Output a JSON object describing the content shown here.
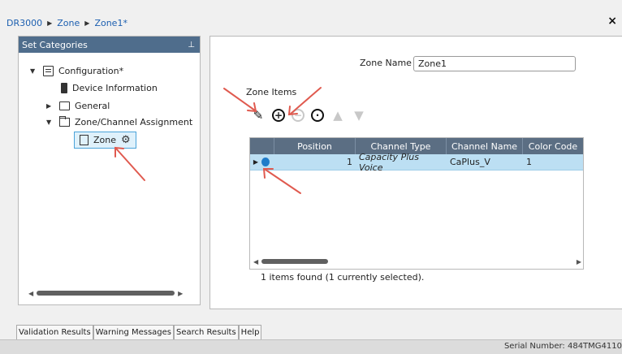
{
  "breadcrumb": {
    "items": [
      "DR3000",
      "Zone",
      "Zone1*"
    ]
  },
  "close_label": "×",
  "left_panel": {
    "title": "Set Categories",
    "pin_icon": "pin-icon",
    "tree": [
      {
        "label": "Configuration*",
        "icon": "configuration-icon"
      },
      {
        "label": "Device Information",
        "icon": "radio-icon"
      },
      {
        "label": "General",
        "icon": "folder-icon"
      },
      {
        "label": "Zone/Channel Assignment",
        "icon": "folder-open-icon"
      },
      {
        "label": "Zone",
        "icon": "document-icon",
        "selected": true
      }
    ]
  },
  "right_panel": {
    "zone_name_label": "Zone Name",
    "zone_name_value": "Zone1",
    "zone_items_label": "Zone Items",
    "toolbar": [
      "edit-icon",
      "add-icon",
      "remove-icon",
      "more-icon",
      "move-up-icon",
      "move-down-icon"
    ],
    "grid": {
      "columns": [
        "Position",
        "Channel Type",
        "Channel Name",
        "Color Code"
      ],
      "rows": [
        {
          "position": "1",
          "channel_type": "Capacity Plus Voice",
          "channel_name": "CaPlus_V",
          "color_code": "1"
        }
      ]
    },
    "items_found": "1 items found (1 currently selected)."
  },
  "bottom_tabs": [
    "Validation Results",
    "Warning Messages",
    "Search Results",
    "Help"
  ],
  "status_bar": {
    "serial": "Serial Number: 484TMG4110"
  },
  "colors": {
    "panel_header": "#4f6d8c",
    "grid_header": "#5b6e83",
    "selected_row": "#bcdff3",
    "annotation_arrow": "#e05a4f"
  }
}
